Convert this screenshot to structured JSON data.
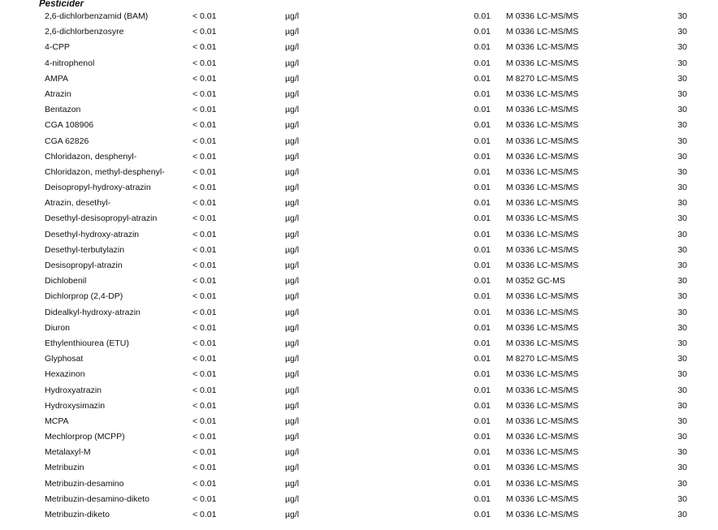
{
  "section": {
    "title": "Pesticider"
  },
  "rows": [
    {
      "name": "2,6-dichlorbenzamid (BAM)",
      "result": "< 0.01",
      "unit": "µg/l",
      "limit": "0.01",
      "method": "M 0336 LC-MS/MS",
      "uncertainty": "30"
    },
    {
      "name": "2,6-dichlorbenzosyre",
      "result": "< 0.01",
      "unit": "µg/l",
      "limit": "0.01",
      "method": "M 0336 LC-MS/MS",
      "uncertainty": "30"
    },
    {
      "name": "4-CPP",
      "result": "< 0.01",
      "unit": "µg/l",
      "limit": "0.01",
      "method": "M 0336 LC-MS/MS",
      "uncertainty": "30"
    },
    {
      "name": "4-nitrophenol",
      "result": "< 0.01",
      "unit": "µg/l",
      "limit": "0.01",
      "method": "M 0336 LC-MS/MS",
      "uncertainty": "30"
    },
    {
      "name": "AMPA",
      "result": "< 0.01",
      "unit": "µg/l",
      "limit": "0.01",
      "method": "M 8270 LC-MS/MS",
      "uncertainty": "30"
    },
    {
      "name": "Atrazin",
      "result": "< 0.01",
      "unit": "µg/l",
      "limit": "0.01",
      "method": "M 0336 LC-MS/MS",
      "uncertainty": "30"
    },
    {
      "name": "Bentazon",
      "result": "< 0.01",
      "unit": "µg/l",
      "limit": "0.01",
      "method": "M 0336 LC-MS/MS",
      "uncertainty": "30"
    },
    {
      "name": "CGA 108906",
      "result": "< 0.01",
      "unit": "µg/l",
      "limit": "0.01",
      "method": "M 0336 LC-MS/MS",
      "uncertainty": "30"
    },
    {
      "name": "CGA 62826",
      "result": "< 0.01",
      "unit": "µg/l",
      "limit": "0.01",
      "method": "M 0336 LC-MS/MS",
      "uncertainty": "30"
    },
    {
      "name": "Chloridazon, desphenyl-",
      "result": "< 0.01",
      "unit": "µg/l",
      "limit": "0.01",
      "method": "M 0336 LC-MS/MS",
      "uncertainty": "30"
    },
    {
      "name": "Chloridazon, methyl-desphenyl-",
      "result": "< 0.01",
      "unit": "µg/l",
      "limit": "0.01",
      "method": "M 0336 LC-MS/MS",
      "uncertainty": "30"
    },
    {
      "name": "Deisopropyl-hydroxy-atrazin",
      "result": "< 0.01",
      "unit": "µg/l",
      "limit": "0.01",
      "method": "M 0336 LC-MS/MS",
      "uncertainty": "30"
    },
    {
      "name": "Atrazin, desethyl-",
      "result": "< 0.01",
      "unit": "µg/l",
      "limit": "0.01",
      "method": "M 0336 LC-MS/MS",
      "uncertainty": "30"
    },
    {
      "name": "Desethyl-desisopropyl-atrazin",
      "result": "< 0.01",
      "unit": "µg/l",
      "limit": "0.01",
      "method": "M 0336 LC-MS/MS",
      "uncertainty": "30"
    },
    {
      "name": "Desethyl-hydroxy-atrazin",
      "result": "< 0.01",
      "unit": "µg/l",
      "limit": "0.01",
      "method": "M 0336 LC-MS/MS",
      "uncertainty": "30"
    },
    {
      "name": "Desethyl-terbutylazin",
      "result": "< 0.01",
      "unit": "µg/l",
      "limit": "0.01",
      "method": "M 0336 LC-MS/MS",
      "uncertainty": "30"
    },
    {
      "name": "Desisopropyl-atrazin",
      "result": "< 0.01",
      "unit": "µg/l",
      "limit": "0.01",
      "method": "M 0336 LC-MS/MS",
      "uncertainty": "30"
    },
    {
      "name": "Dichlobenil",
      "result": "< 0.01",
      "unit": "µg/l",
      "limit": "0.01",
      "method": "M 0352 GC-MS",
      "uncertainty": "30"
    },
    {
      "name": "Dichlorprop (2,4-DP)",
      "result": "< 0.01",
      "unit": "µg/l",
      "limit": "0.01",
      "method": "M 0336 LC-MS/MS",
      "uncertainty": "30"
    },
    {
      "name": "Didealkyl-hydroxy-atrazin",
      "result": "< 0.01",
      "unit": "µg/l",
      "limit": "0.01",
      "method": "M 0336 LC-MS/MS",
      "uncertainty": "30"
    },
    {
      "name": "Diuron",
      "result": "< 0.01",
      "unit": "µg/l",
      "limit": "0.01",
      "method": "M 0336 LC-MS/MS",
      "uncertainty": "30"
    },
    {
      "name": "Ethylenthiourea (ETU)",
      "result": "< 0.01",
      "unit": "µg/l",
      "limit": "0.01",
      "method": "M 0336 LC-MS/MS",
      "uncertainty": "30"
    },
    {
      "name": "Glyphosat",
      "result": "< 0.01",
      "unit": "µg/l",
      "limit": "0.01",
      "method": "M 8270 LC-MS/MS",
      "uncertainty": "30"
    },
    {
      "name": "Hexazinon",
      "result": "< 0.01",
      "unit": "µg/l",
      "limit": "0.01",
      "method": "M 0336 LC-MS/MS",
      "uncertainty": "30"
    },
    {
      "name": "Hydroxyatrazin",
      "result": "< 0.01",
      "unit": "µg/l",
      "limit": "0.01",
      "method": "M 0336 LC-MS/MS",
      "uncertainty": "30"
    },
    {
      "name": "Hydroxysimazin",
      "result": "< 0.01",
      "unit": "µg/l",
      "limit": "0.01",
      "method": "M 0336 LC-MS/MS",
      "uncertainty": "30"
    },
    {
      "name": "MCPA",
      "result": "< 0.01",
      "unit": "µg/l",
      "limit": "0.01",
      "method": "M 0336 LC-MS/MS",
      "uncertainty": "30"
    },
    {
      "name": "Mechlorprop (MCPP)",
      "result": "< 0.01",
      "unit": "µg/l",
      "limit": "0.01",
      "method": "M 0336 LC-MS/MS",
      "uncertainty": "30"
    },
    {
      "name": "Metalaxyl-M",
      "result": "< 0.01",
      "unit": "µg/l",
      "limit": "0.01",
      "method": "M 0336 LC-MS/MS",
      "uncertainty": "30"
    },
    {
      "name": "Metribuzin",
      "result": "< 0.01",
      "unit": "µg/l",
      "limit": "0.01",
      "method": "M 0336 LC-MS/MS",
      "uncertainty": "30"
    },
    {
      "name": "Metribuzin-desamino",
      "result": "< 0.01",
      "unit": "µg/l",
      "limit": "0.01",
      "method": "M 0336 LC-MS/MS",
      "uncertainty": "30"
    },
    {
      "name": "Metribuzin-desamino-diketo",
      "result": "< 0.01",
      "unit": "µg/l",
      "limit": "0.01",
      "method": "M 0336 LC-MS/MS",
      "uncertainty": "30"
    },
    {
      "name": "Metribuzin-diketo",
      "result": "< 0.01",
      "unit": "µg/l",
      "limit": "0.01",
      "method": "M 0336 LC-MS/MS",
      "uncertainty": "30"
    }
  ]
}
